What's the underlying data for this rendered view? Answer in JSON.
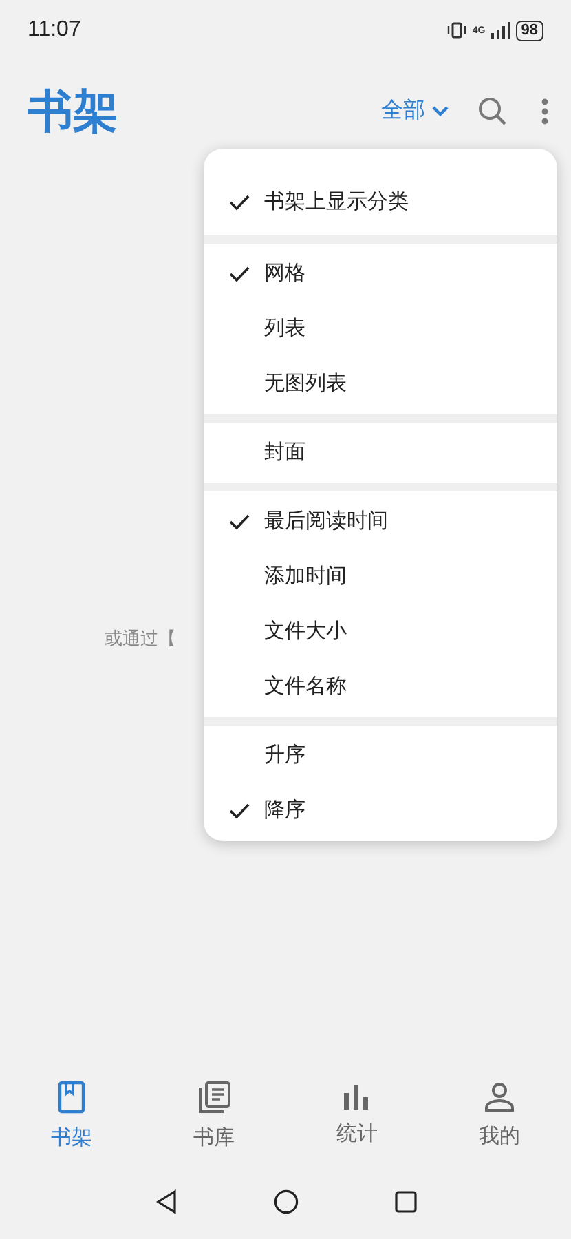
{
  "status_bar": {
    "time": "11:07",
    "network": "4G",
    "battery": "98"
  },
  "header": {
    "title": "书架",
    "filter": "全部"
  },
  "empty_hint": "或通过【",
  "menu": {
    "groups": [
      {
        "items": [
          {
            "label": "书架上显示分类",
            "checked": true
          }
        ]
      },
      {
        "items": [
          {
            "label": "网格",
            "checked": true
          },
          {
            "label": "列表",
            "checked": false
          },
          {
            "label": "无图列表",
            "checked": false
          }
        ]
      },
      {
        "items": [
          {
            "label": "封面",
            "checked": false
          }
        ]
      },
      {
        "items": [
          {
            "label": "最后阅读时间",
            "checked": true
          },
          {
            "label": "添加时间",
            "checked": false
          },
          {
            "label": "文件大小",
            "checked": false
          },
          {
            "label": "文件名称",
            "checked": false
          }
        ]
      },
      {
        "items": [
          {
            "label": "升序",
            "checked": false
          },
          {
            "label": "降序",
            "checked": true
          }
        ]
      }
    ]
  },
  "bottom_nav": [
    {
      "kind": "bookshelf",
      "label": "书架",
      "selected": true
    },
    {
      "kind": "library",
      "label": "书库",
      "selected": false
    },
    {
      "kind": "stats",
      "label": "统计",
      "selected": false
    },
    {
      "kind": "profile",
      "label": "我的",
      "selected": false
    }
  ]
}
